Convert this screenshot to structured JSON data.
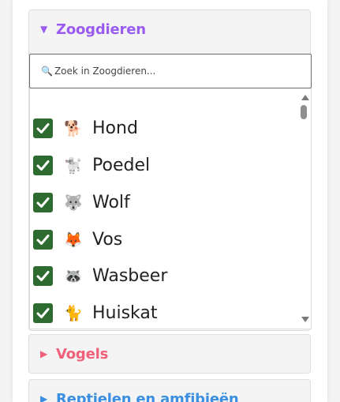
{
  "sections": [
    {
      "title": "Zoogdieren",
      "arrow": "▼",
      "color": "#9a5bf0",
      "expanded": true
    },
    {
      "title": "Vogels",
      "arrow": "▶",
      "color": "#f0607a",
      "expanded": false
    },
    {
      "title": "Reptielen en amfibieën",
      "arrow": "▶",
      "color": "#3a8fe0",
      "expanded": false
    }
  ],
  "search": {
    "icon": "🔍",
    "placeholder": "Zoek in Zoogdieren..."
  },
  "items": [
    {
      "label": "Hond",
      "emoji": "🐕",
      "checked": true
    },
    {
      "label": "Poedel",
      "emoji": "🐩",
      "checked": true
    },
    {
      "label": "Wolf",
      "emoji": "🐺",
      "checked": true
    },
    {
      "label": "Vos",
      "emoji": "🦊",
      "checked": true
    },
    {
      "label": "Wasbeer",
      "emoji": "🦝",
      "checked": true
    },
    {
      "label": "Huiskat",
      "emoji": "🐈",
      "checked": true
    }
  ],
  "colors": {
    "checkbox": "#2e6b31"
  }
}
